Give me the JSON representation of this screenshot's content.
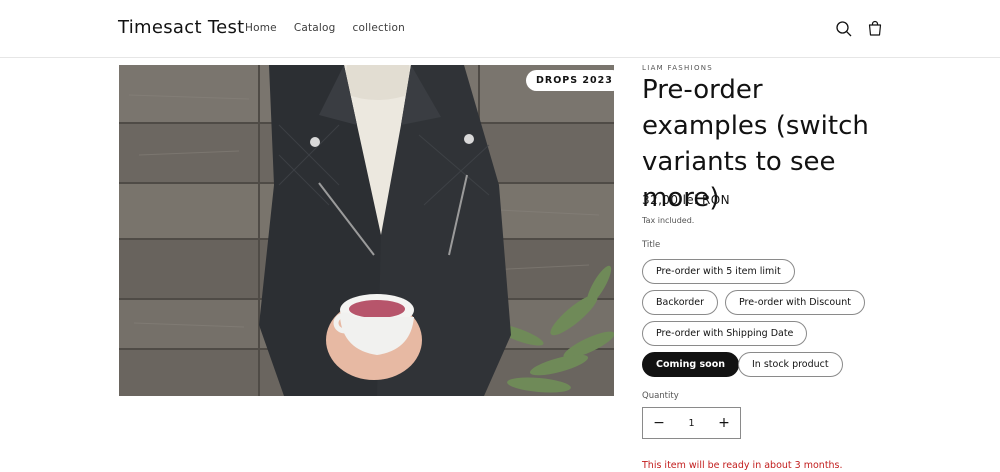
{
  "header": {
    "brand": "Timesact Test",
    "nav": [
      "Home",
      "Catalog",
      "collection"
    ],
    "icons": [
      "search-icon",
      "cart-icon"
    ]
  },
  "media": {
    "badge": "DROPS 2023",
    "image": "woman-leather-jacket-holding-cup"
  },
  "product": {
    "vendor": "LIAM FASHIONS",
    "title": "Pre-order examples (switch variants to see more)",
    "price": "32,00 lei RON",
    "tax_note": "Tax included.",
    "option_label": "Title",
    "variants": [
      {
        "label": "Pre-order with 5 item limit",
        "selected": false
      },
      {
        "label": "Backorder",
        "selected": false
      },
      {
        "label": "Pre-order with Discount",
        "selected": false
      },
      {
        "label": "Pre-order with Shipping Date",
        "selected": false
      },
      {
        "label": "Coming soon",
        "selected": true
      },
      {
        "label": "In stock product",
        "selected": false
      }
    ],
    "quantity_label": "Quantity",
    "quantity_value": "1",
    "quantity_minus": "−",
    "quantity_plus": "+",
    "availability_notice": "This item will be ready in about 3 months."
  },
  "colors": {
    "text": "#121212",
    "selected_pill": "#121212",
    "notice": "#c21d1d"
  }
}
